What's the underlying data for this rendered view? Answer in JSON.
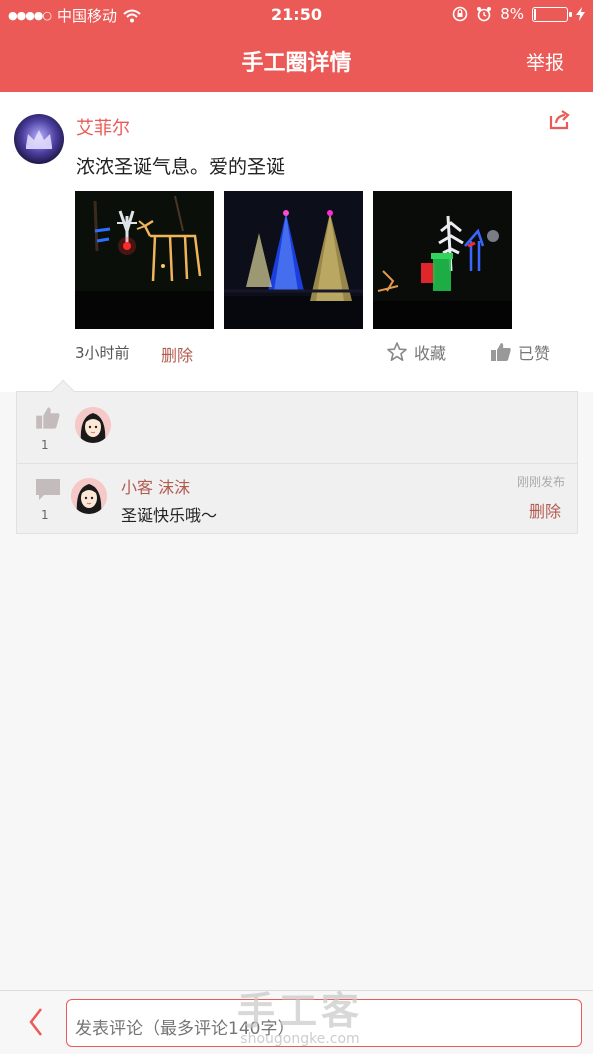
{
  "status_bar": {
    "signal_dots": "●●●●○",
    "carrier": "中国移动",
    "wifi_icon": "wifi-icon",
    "time": "21:50",
    "battery_percent": "8%",
    "battery_level": 0.08
  },
  "nav": {
    "title": "手工圈详情",
    "report_label": "举报"
  },
  "post": {
    "username": "艾菲尔",
    "content": "浓浓圣诞气息。爱的圣诞",
    "time": "3小时前",
    "delete_label": "删除",
    "collect_label": "收藏",
    "liked_label": "已赞",
    "photos": [
      "christmas-reindeer-lights-photo",
      "christmas-trees-lights-photo",
      "christmas-garden-lights-photo"
    ]
  },
  "likes": {
    "count": "1"
  },
  "comments": {
    "count": "1",
    "items": [
      {
        "name": "小客 沫沫",
        "text": "圣诞快乐哦～",
        "time": "刚刚发布",
        "delete_label": "删除"
      }
    ]
  },
  "bottom": {
    "placeholder": "发表评论（最多评论140字）"
  },
  "watermark": {
    "big": "手工客",
    "small": "shougongke.com"
  },
  "colors": {
    "brand": "#eb5a56",
    "link": "#b25b4f"
  }
}
